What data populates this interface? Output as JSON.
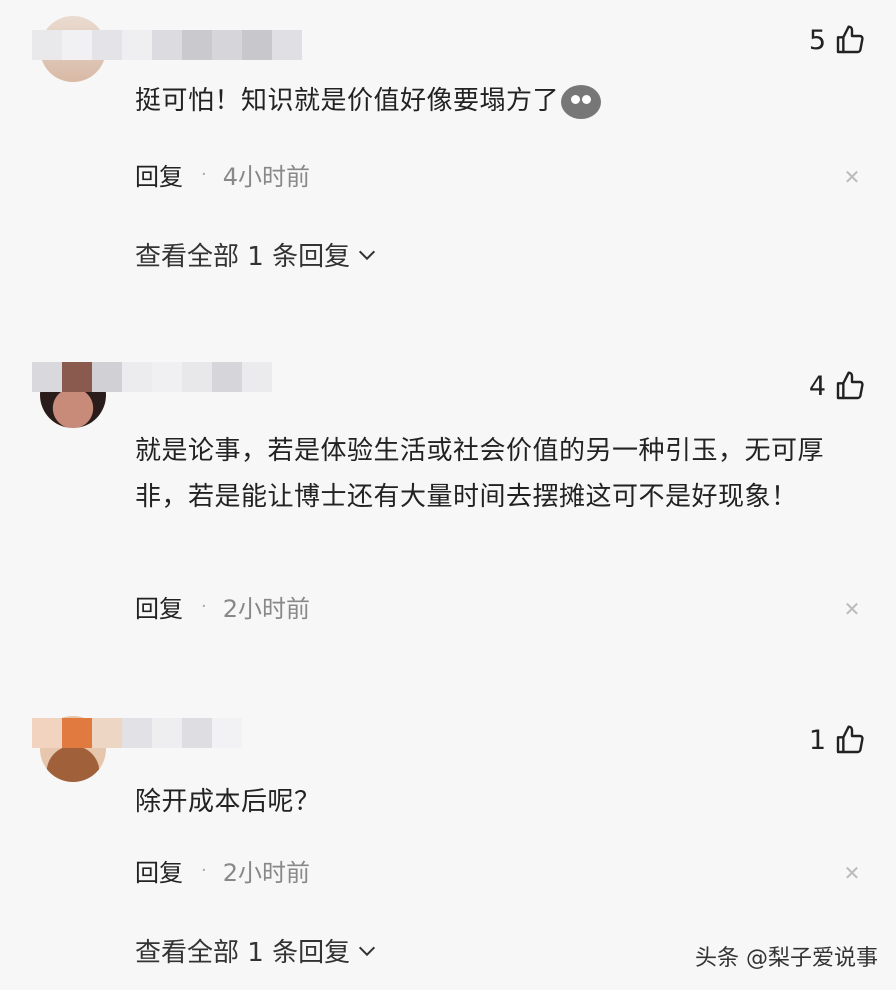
{
  "comments": [
    {
      "likes": "5",
      "text": "挺可怕！知识就是价值好像要塌方了",
      "reply_label": "回复",
      "time": "4小时前",
      "more": "查看全部 1 条回复"
    },
    {
      "likes": "4",
      "text": "就是论事，若是体验生活或社会价值的另一种引玉，无可厚非，若是能让博士还有大量时间去摆摊这可不是好现象！",
      "reply_label": "回复",
      "time": "2小时前"
    },
    {
      "likes": "1",
      "text": "除开成本后呢？",
      "reply_label": "回复",
      "time": "2小时前",
      "more": "查看全部 1 条回复"
    }
  ],
  "watermark": "头条 @梨子爱说事",
  "icons": {
    "like": "thumbs-up-icon",
    "close": "close-icon",
    "chevron": "chevron-down-icon",
    "emoji": "shocked-face-emoji"
  }
}
